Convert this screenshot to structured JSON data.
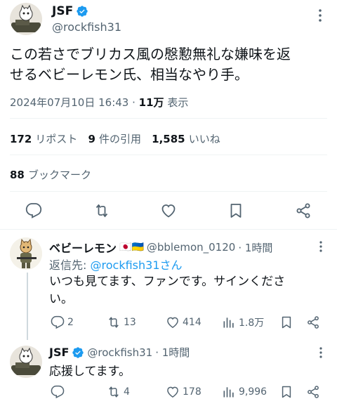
{
  "main_tweet": {
    "author_name": "JSF",
    "handle": "@rockfish31",
    "text_line1": "この若さでブリカス風の慇懃無礼な嫌味を返",
    "text_line2": "せるベビーレモン氏、相当なやり手。",
    "timestamp": "2024年07月10日 16:43",
    "views_num": "11万",
    "views_label": "表示",
    "reposts_num": "172",
    "reposts_label": "リポスト",
    "quotes_num": "9",
    "quotes_label": "件の引用",
    "likes_num": "1,585",
    "likes_label": "いいね",
    "bookmarks_num": "88",
    "bookmarks_label": "ブックマーク"
  },
  "reply1": {
    "author_name": "ベビーレモン",
    "flags": "🇯🇵🇺🇦",
    "handle": "@bblemon_0120",
    "time": "· 1時間",
    "reply_to_label": "返信先:",
    "reply_to_handle": "@rockfish31さん",
    "text_line1": "いつも見てます、ファンです。サインくださ",
    "text_line2": "い。",
    "replies": "2",
    "reposts": "13",
    "likes": "414",
    "views": "1.8万"
  },
  "reply2": {
    "author_name": "JSF",
    "handle": "@rockfish31",
    "time": "· 1時間",
    "text": "応援してます。",
    "replies": "",
    "reposts": "4",
    "likes": "178",
    "views": "9,996"
  },
  "colors": {
    "text": "#0f1419",
    "secondary": "#536471",
    "link": "#1d9bf0",
    "verified": "#1d9bf0",
    "divider": "#eff3f4"
  },
  "icons": [
    "verified-badge-icon",
    "more-icon",
    "reply-icon",
    "repost-icon",
    "like-icon",
    "bookmark-icon",
    "share-icon",
    "views-icon"
  ]
}
